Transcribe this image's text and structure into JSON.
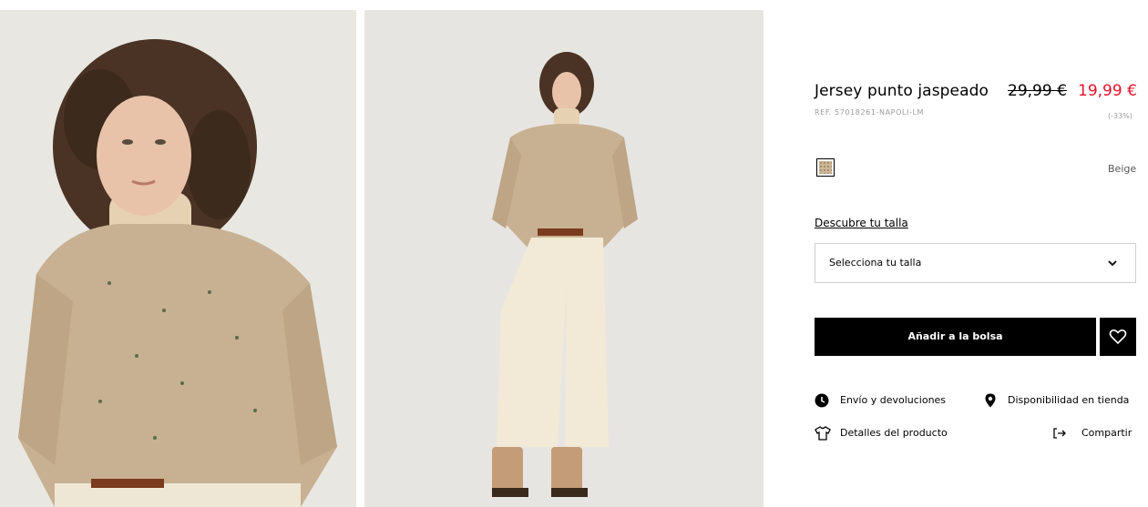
{
  "product": {
    "title": "Jersey punto jaspeado",
    "old_price": "29,99 €",
    "new_price": "19,99 €",
    "reference": "REF. 57018261-NAPOLI-LM",
    "discount": "(-33%)",
    "color_name": "Beige"
  },
  "size": {
    "guide_link": "Descubre tu talla",
    "select_label": "Selecciona tu talla"
  },
  "actions": {
    "add_to_bag": "Añadir a la bolsa"
  },
  "links": {
    "shipping": "Envío y devoluciones",
    "availability": "Disponibilidad en tienda",
    "details": "Detalles del producto",
    "share": "Compartir"
  },
  "colors": {
    "sale_price": "#e3112b",
    "button_bg": "#000000",
    "swatch": "#cbb696"
  },
  "icons": [
    "clock-icon",
    "location-pin-icon",
    "tshirt-icon",
    "share-icon",
    "heart-icon",
    "chevron-down-icon"
  ]
}
